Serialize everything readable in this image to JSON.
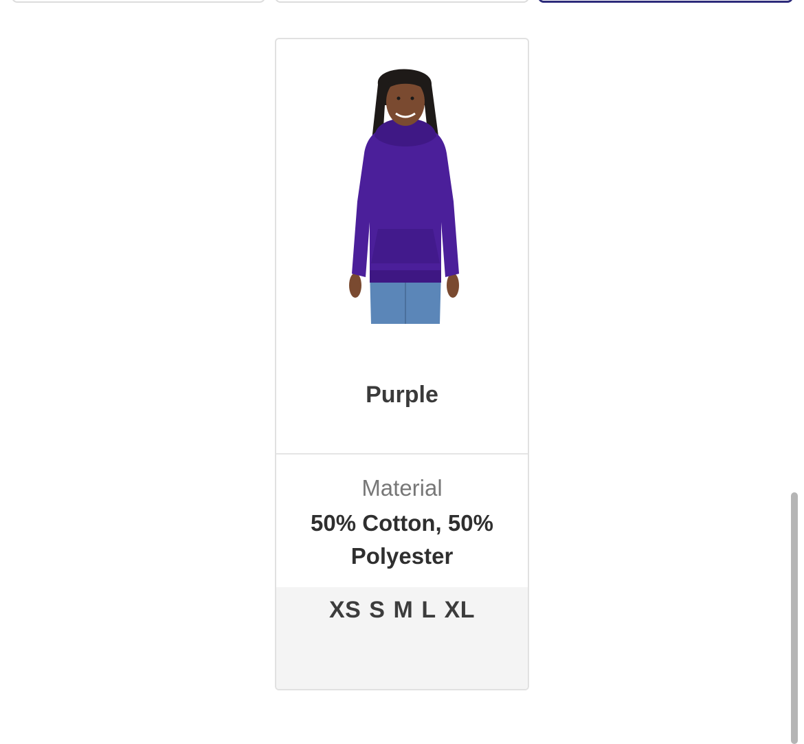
{
  "product": {
    "color_name": "Purple",
    "image_icon": "hoodie-product-photo",
    "hoodie_color": "#4b1f9a",
    "jeans_color": "#5b86b8"
  },
  "details": {
    "material_label": "Material",
    "material_value": "50% Cotton, 50% Polyester"
  },
  "sizes": [
    "XS",
    "S",
    "M",
    "L",
    "XL"
  ],
  "colors": {
    "selected_tab_border": "#2c2a7a",
    "card_border": "#e1e1e1",
    "sizes_background": "#f4f4f4"
  }
}
